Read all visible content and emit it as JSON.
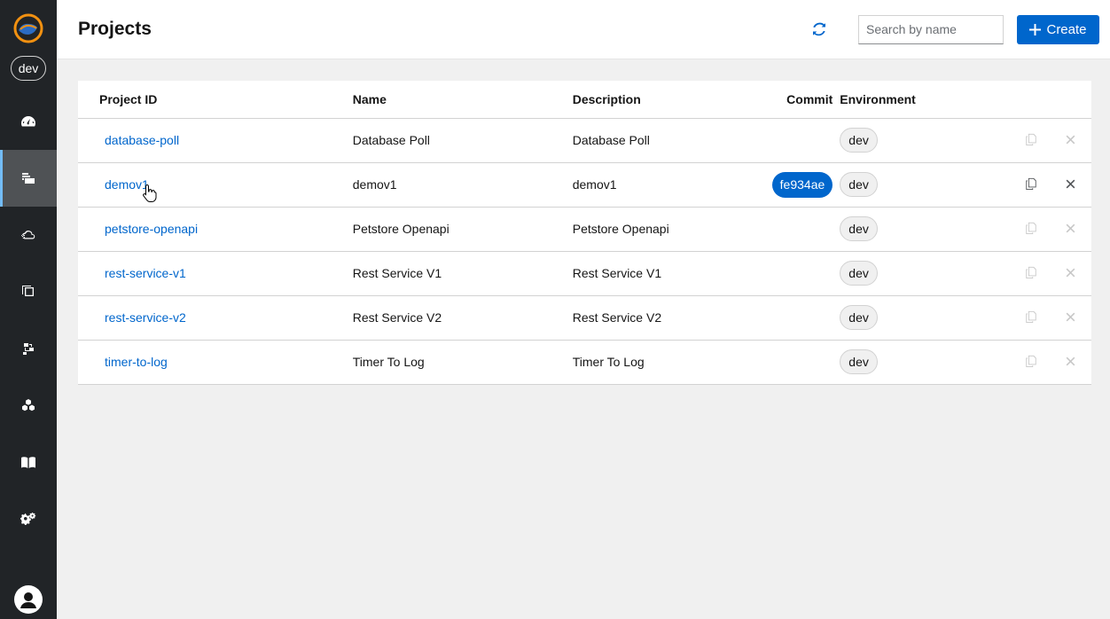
{
  "sidebar": {
    "env": "dev",
    "items": [
      {
        "icon": "dashboard-icon"
      },
      {
        "icon": "projects-icon",
        "active": true
      },
      {
        "icon": "cloud-deploy-icon"
      },
      {
        "icon": "templates-icon"
      },
      {
        "icon": "integrations-icon"
      },
      {
        "icon": "cluster-icon"
      },
      {
        "icon": "docs-book-icon"
      },
      {
        "icon": "settings-gears-icon"
      }
    ],
    "avatar_icon": "user-avatar-icon"
  },
  "header": {
    "title": "Projects",
    "search_placeholder": "Search by name",
    "create_label": "Create"
  },
  "table": {
    "columns": {
      "id": "Project ID",
      "name": "Name",
      "description": "Description",
      "commit": "Commit",
      "environment": "Environment"
    },
    "rows": [
      {
        "id": "database-poll",
        "name": "Database Poll",
        "description": "Database Poll",
        "commit": "",
        "environment": "dev",
        "actions_enabled": false
      },
      {
        "id": "demov1",
        "name": "demov1",
        "description": "demov1",
        "commit": "fe934ae",
        "environment": "dev",
        "actions_enabled": true
      },
      {
        "id": "petstore-openapi",
        "name": "Petstore Openapi",
        "description": "Petstore Openapi",
        "commit": "",
        "environment": "dev",
        "actions_enabled": false
      },
      {
        "id": "rest-service-v1",
        "name": "Rest Service V1",
        "description": "Rest Service V1",
        "commit": "",
        "environment": "dev",
        "actions_enabled": false
      },
      {
        "id": "rest-service-v2",
        "name": "Rest Service V2",
        "description": "Rest Service V2",
        "commit": "",
        "environment": "dev",
        "actions_enabled": false
      },
      {
        "id": "timer-to-log",
        "name": "Timer To Log",
        "description": "Timer To Log",
        "commit": "",
        "environment": "dev",
        "actions_enabled": false
      }
    ]
  },
  "colors": {
    "sidebar_bg": "#212427",
    "accent": "#0066cc",
    "page_bg": "#f0f0f0"
  }
}
